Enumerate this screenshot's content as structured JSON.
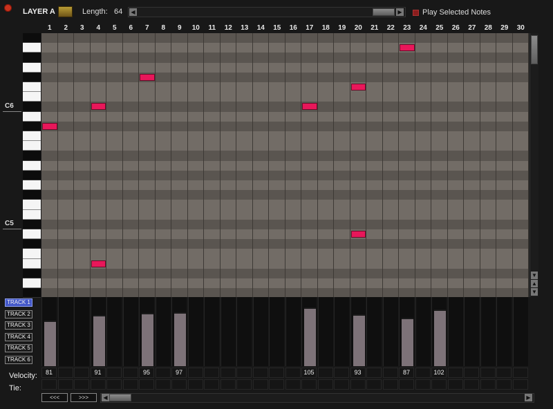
{
  "header": {
    "layer_title": "LAYER A",
    "length_label": "Length:",
    "length_value": "64",
    "play_selected_label": "Play Selected Notes"
  },
  "columns": [
    "1",
    "2",
    "3",
    "4",
    "5",
    "6",
    "7",
    "8",
    "9",
    "10",
    "11",
    "12",
    "13",
    "14",
    "15",
    "16",
    "17",
    "18",
    "19",
    "20",
    "21",
    "22",
    "23",
    "24",
    "25",
    "26",
    "27",
    "28",
    "29",
    "30"
  ],
  "octave_labels": [
    "C6",
    "C5"
  ],
  "notes": [
    {
      "col": 23,
      "row": 1
    },
    {
      "col": 7,
      "row": 4
    },
    {
      "col": 20,
      "row": 5
    },
    {
      "col": 4,
      "row": 7
    },
    {
      "col": 17,
      "row": 7
    },
    {
      "col": 1,
      "row": 9
    },
    {
      "col": 20,
      "row": 20
    },
    {
      "col": 4,
      "row": 23
    }
  ],
  "tracks": [
    "TRACK 1",
    "TRACK 2",
    "TRACK 3",
    "TRACK 4",
    "TRACK 5",
    "TRACK 6"
  ],
  "active_track": 0,
  "velocity_label": "Velocity:",
  "tie_label": "Tie:",
  "velocities": [
    {
      "col": 1,
      "value": "81"
    },
    {
      "col": 4,
      "value": "91"
    },
    {
      "col": 7,
      "value": "95"
    },
    {
      "col": 9,
      "value": "97"
    },
    {
      "col": 17,
      "value": "105"
    },
    {
      "col": 20,
      "value": "93"
    },
    {
      "col": 23,
      "value": "87"
    },
    {
      "col": 25,
      "value": "102"
    }
  ],
  "nav": {
    "prev": "<<<",
    "next": ">>>"
  },
  "colors": {
    "note": "#e8175a",
    "active_track": "#4458c8",
    "velocity_bar": "#7d7278"
  }
}
